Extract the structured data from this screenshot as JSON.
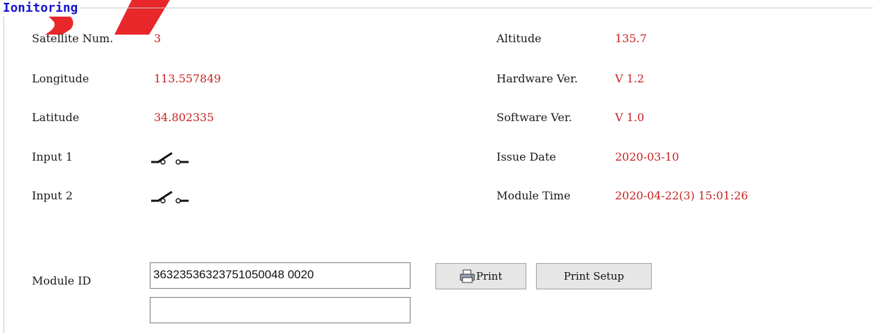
{
  "panel": {
    "title_prefix": "I",
    "title_rest": "onitoring"
  },
  "left": {
    "satellite_label": "Satellite Num.",
    "satellite_value": "3",
    "longitude_label": "Longitude",
    "longitude_value": "113.557849",
    "latitude_label": "Latitude",
    "latitude_value": "34.802335",
    "input1_label": "Input 1",
    "input1_state_icon": "switch-open-icon",
    "input2_label": "Input 2",
    "input2_state_icon": "switch-open-icon"
  },
  "right": {
    "altitude_label": "Altitude",
    "altitude_value": "135.7",
    "hardware_label": "Hardware Ver.",
    "hardware_value": "V 1.2",
    "software_label": "Software Ver.",
    "software_value": "V 1.0",
    "issue_label": "Issue Date",
    "issue_value": "2020-03-10",
    "module_time_label": "Module Time",
    "module_time_value": "2020-04-22(3) 15:01:26"
  },
  "module": {
    "id_label": "Module ID",
    "id_value": "36323536323751050048 0020",
    "second_value": ""
  },
  "buttons": {
    "print_label": "Print",
    "print_setup_label": "Print Setup"
  },
  "colors": {
    "value": "#c8211f",
    "title": "#1515d0",
    "watermark": "#e8272b"
  }
}
